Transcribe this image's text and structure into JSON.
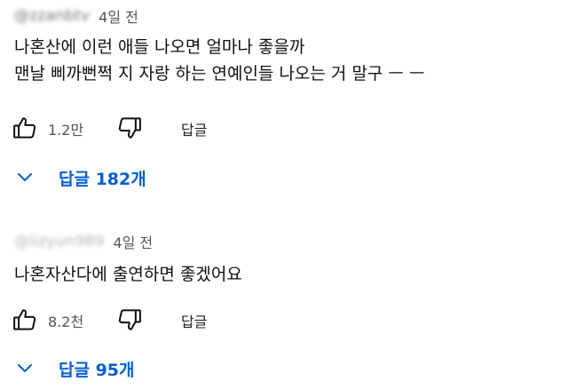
{
  "comments": [
    {
      "handle": "@zzanbtv",
      "time": "4일 전",
      "lines": [
        "나혼산에 이런 애들 나오면 얼마나 좋을까",
        "맨날 삐까뻔쩍 지 자랑 하는 연예인들 나오는 거 말구 ㅡ ㅡ"
      ],
      "like_count": "1.2만",
      "reply_label": "답글",
      "replies_label": "답글 182개"
    },
    {
      "handle": "@lizyun989",
      "time": "4일 전",
      "lines": [
        "나혼자산다에 출연하면 좋겠어요"
      ],
      "like_count": "8.2천",
      "reply_label": "답글",
      "replies_label": "답글 95개"
    }
  ],
  "icons": {
    "like": "thumbs-up-icon",
    "dislike": "thumbs-down-icon",
    "expand": "chevron-down-icon"
  },
  "colors": {
    "link_blue": "#065fd4",
    "text": "#0f0f0f",
    "meta_gray": "#555555"
  }
}
